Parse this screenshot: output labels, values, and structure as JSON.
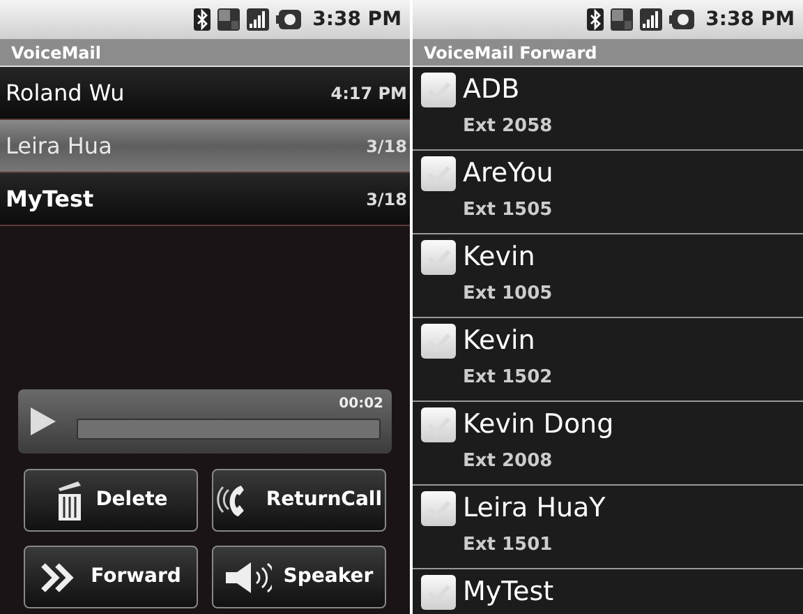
{
  "screens": [
    {
      "status_bar": {
        "time": "3:38 PM"
      },
      "title": "VoiceMail",
      "messages": [
        {
          "name": "Roland Wu",
          "time": "4:17 PM",
          "selected": false,
          "unread": false
        },
        {
          "name": "Leira Hua",
          "time": "3/18",
          "selected": true,
          "unread": false
        },
        {
          "name": "MyTest",
          "time": "3/18",
          "selected": false,
          "unread": true
        }
      ],
      "player": {
        "elapsed": "00:02",
        "level": 0
      },
      "buttons": [
        {
          "label": "Delete",
          "kind": "delete"
        },
        {
          "label": "ReturnCall",
          "kind": "call"
        },
        {
          "label": "Forward",
          "kind": "forward"
        },
        {
          "label": "Speaker",
          "kind": "speaker"
        }
      ]
    },
    {
      "status_bar": {
        "time": "3:38 PM"
      },
      "title": "VoiceMail Forward",
      "contacts": [
        {
          "name": "ADB",
          "ext": "Ext 2058",
          "checked": false
        },
        {
          "name": "AreYou",
          "ext": "Ext 1505",
          "checked": false
        },
        {
          "name": "Kevin",
          "ext": "Ext 1005",
          "checked": false
        },
        {
          "name": "Kevin",
          "ext": "Ext 1502",
          "checked": false
        },
        {
          "name": "Kevin Dong",
          "ext": "Ext 2008",
          "checked": false
        },
        {
          "name": "Leira HuaY",
          "ext": "Ext 1501",
          "checked": false
        },
        {
          "name": "MyTest",
          "checked": false
        }
      ]
    }
  ]
}
